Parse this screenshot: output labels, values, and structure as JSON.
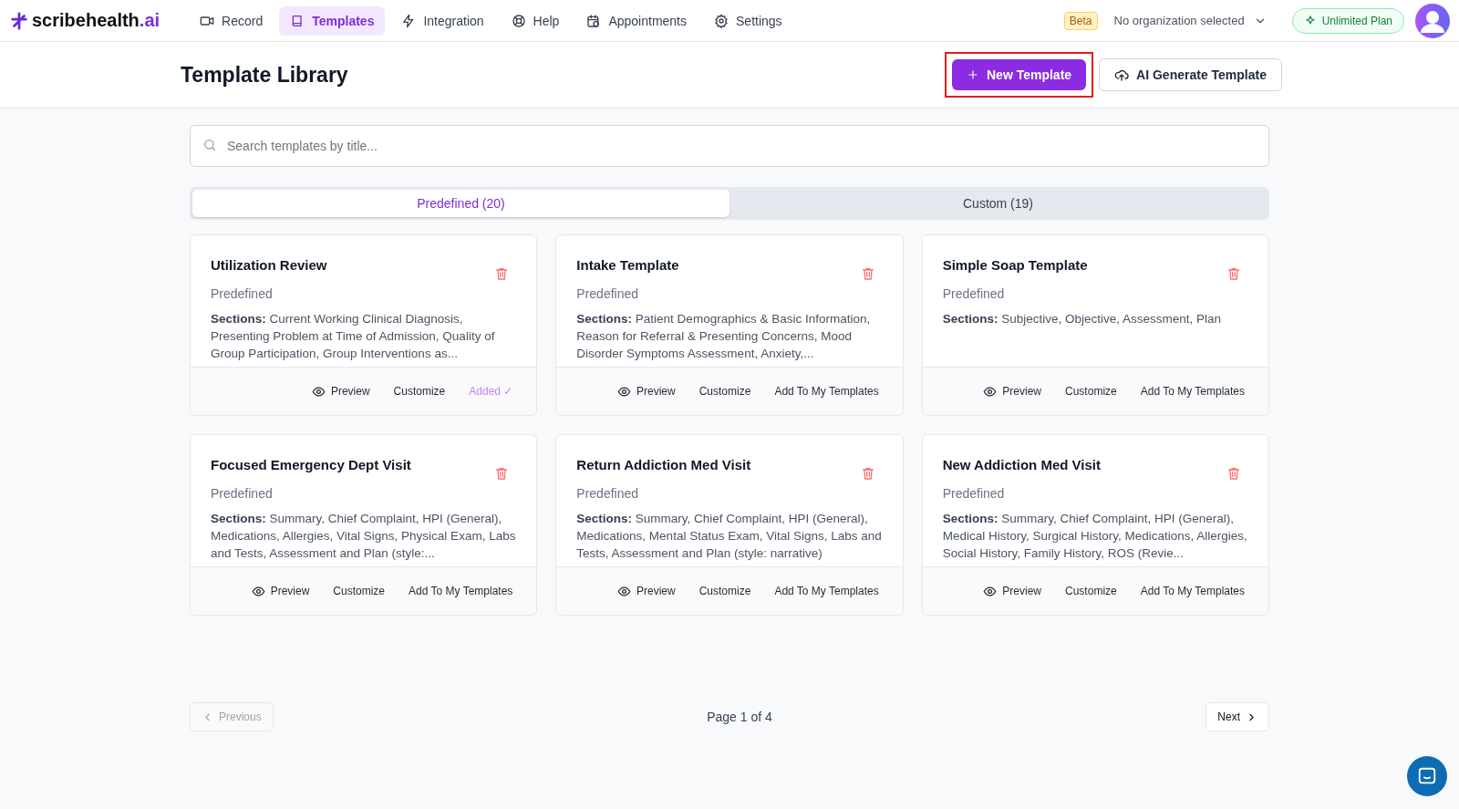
{
  "brand": {
    "name": "scribehealth",
    "suffix": ".ai"
  },
  "nav": [
    {
      "label": "Record",
      "kind": "record",
      "selected": false
    },
    {
      "label": "Templates",
      "kind": "templates",
      "selected": true
    },
    {
      "label": "Integration",
      "kind": "integration",
      "selected": false
    },
    {
      "label": "Help",
      "kind": "help",
      "selected": false
    },
    {
      "label": "Appointments",
      "kind": "appointments",
      "selected": false
    },
    {
      "label": "Settings",
      "kind": "settings",
      "selected": false
    }
  ],
  "header_right": {
    "badge": "Beta",
    "organization": "No organization selected",
    "plan": "Unlimited Plan"
  },
  "page": {
    "title": "Template Library",
    "buttons": [
      {
        "label": "New Template",
        "kind": "primary",
        "highlighted": true
      },
      {
        "label": "AI Generate Template",
        "kind": "secondary",
        "highlighted": false
      }
    ]
  },
  "search": {
    "placeholder": "Search templates by title..."
  },
  "tabs": [
    {
      "label": "Predefined (20)",
      "selected": true
    },
    {
      "label": "Custom (19)",
      "selected": false
    }
  ],
  "cards": [
    {
      "title": "Utilization Review",
      "type": "Predefined",
      "sections": "**Sections:** Current Working Clinical Diagnosis, Presenting Problem at Time of Admission, Quality of Group Participation, Group Interventions as...",
      "actions": [
        {
          "label": "Preview",
          "kind": "preview"
        },
        {
          "label": "Customize",
          "kind": "customize"
        },
        {
          "label": "Added ✓",
          "kind": "added"
        }
      ]
    },
    {
      "title": "Intake Template",
      "type": "Predefined",
      "sections": "**Sections:** Patient Demographics & Basic Information, Reason for Referral & Presenting Concerns, Mood Disorder Symptoms Assessment, Anxiety,...",
      "actions": [
        {
          "label": "Preview",
          "kind": "preview"
        },
        {
          "label": "Customize",
          "kind": "customize"
        },
        {
          "label": "Add To My Templates",
          "kind": "add"
        }
      ]
    },
    {
      "title": "Simple Soap Template",
      "type": "Predefined",
      "sections": "**Sections:** Subjective, Objective, Assessment, Plan",
      "actions": [
        {
          "label": "Preview",
          "kind": "preview"
        },
        {
          "label": "Customize",
          "kind": "customize"
        },
        {
          "label": "Add To My Templates",
          "kind": "add"
        }
      ]
    },
    {
      "title": "Focused Emergency Dept Visit",
      "type": "Predefined",
      "sections": "**Sections:** Summary, Chief Complaint, HPI (General), Medications, Allergies, Vital Signs, Physical Exam, Labs and Tests, Assessment and Plan (style:...",
      "actions": [
        {
          "label": "Preview",
          "kind": "preview"
        },
        {
          "label": "Customize",
          "kind": "customize"
        },
        {
          "label": "Add To My Templates",
          "kind": "add"
        }
      ]
    },
    {
      "title": "Return Addiction Med Visit",
      "type": "Predefined",
      "sections": "**Sections:** Summary, Chief Complaint, HPI (General), Medications, Mental Status Exam, Vital Signs, Labs and Tests, Assessment and Plan (style: narrative)",
      "actions": [
        {
          "label": "Preview",
          "kind": "preview"
        },
        {
          "label": "Customize",
          "kind": "customize"
        },
        {
          "label": "Add To My Templates",
          "kind": "add"
        }
      ]
    },
    {
      "title": "New Addiction Med Visit",
      "type": "Predefined",
      "sections": "**Sections:** Summary, Chief Complaint, HPI (General), Medical History, Surgical History, Medications, Allergies, Social History, Family History, ROS (Revie...",
      "actions": [
        {
          "label": "Preview",
          "kind": "preview"
        },
        {
          "label": "Customize",
          "kind": "customize"
        },
        {
          "label": "Add To My Templates",
          "kind": "add"
        }
      ]
    }
  ],
  "pagination": {
    "previous": {
      "label": "Previous",
      "disabled": true
    },
    "page": "Page 1 of 4",
    "next": {
      "label": "Next",
      "disabled": false
    }
  }
}
